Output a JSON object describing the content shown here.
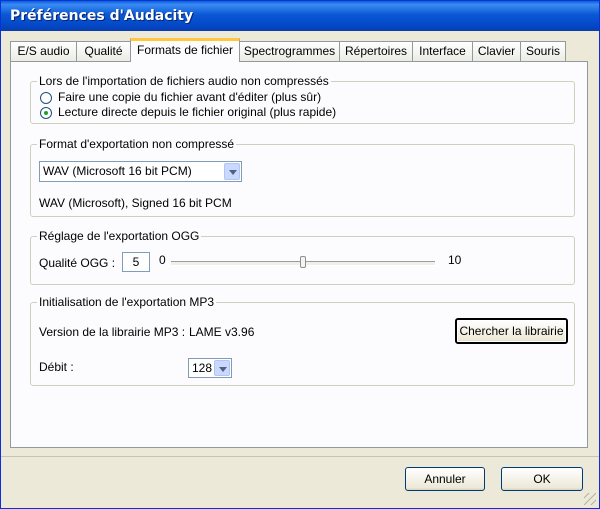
{
  "window": {
    "title": "Préférences d'Audacity"
  },
  "tabs": [
    {
      "label": "E/S audio",
      "active": false
    },
    {
      "label": "Qualité",
      "active": false
    },
    {
      "label": "Formats de fichier",
      "active": true
    },
    {
      "label": "Spectrogrammes",
      "active": false
    },
    {
      "label": "Répertoires",
      "active": false
    },
    {
      "label": "Interface",
      "active": false
    },
    {
      "label": "Clavier",
      "active": false
    },
    {
      "label": "Souris",
      "active": false
    }
  ],
  "import_group": {
    "title": "Lors de l'importation de fichiers audio non compressés",
    "options": [
      {
        "label": "Faire une copie du fichier avant d'éditer (plus sûr)",
        "checked": false
      },
      {
        "label": "Lecture directe depuis le fichier original (plus rapide)",
        "checked": true
      }
    ]
  },
  "export_format_group": {
    "title": "Format d'exportation non compressé",
    "selected_format": "WAV (Microsoft 16 bit PCM)",
    "description": "WAV (Microsoft), Signed 16 bit PCM"
  },
  "ogg_group": {
    "title": "Réglage de l'exportation OGG",
    "quality_label": "Qualité OGG :",
    "quality_value": "5",
    "min_label": "0",
    "max_label": "10",
    "slider_value": 5,
    "slider_min": 0,
    "slider_max": 10
  },
  "mp3_group": {
    "title": "Initialisation de l'exportation MP3",
    "library_label": "Version de la librairie MP3 :",
    "library_version": "LAME v3.96",
    "find_library_button": "Chercher la librairie",
    "bitrate_label": "Débit :",
    "bitrate_value": "128"
  },
  "footer": {
    "cancel_button": "Annuler",
    "ok_button": "OK"
  }
}
